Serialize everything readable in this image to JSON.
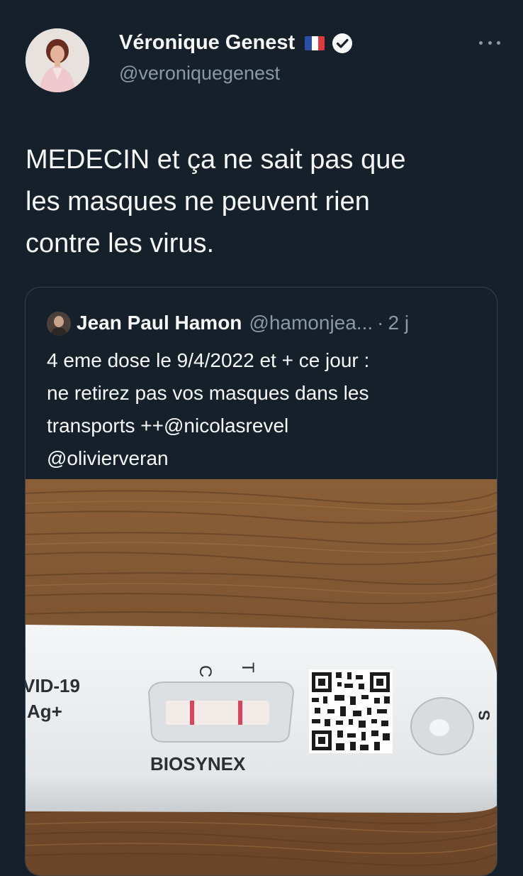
{
  "author": {
    "name": "Véronique Genest",
    "handle": "@veroniquegenest"
  },
  "tweet": {
    "lines": [
      "MEDECIN et ça ne sait pas que",
      "les masques ne peuvent rien",
      "contre les virus."
    ]
  },
  "quoted": {
    "name": "Jean Paul Hamon",
    "handle": "@hamonjea...",
    "separator": "·",
    "time": "2 j",
    "lines": [
      "4 eme dose le 9/4/2022 et + ce jour :",
      "ne retirez pas vos masques dans les",
      "transports ++@nicolasrevel",
      "@olivierveran"
    ],
    "image": {
      "cassette_text": [
        "VID-19",
        "Ag+"
      ],
      "brand": "BIOSYNEX",
      "marker_c": "C",
      "marker_t": "T",
      "edge_letter": "S"
    }
  },
  "colors": {
    "background": "#15202b",
    "text_primary": "#f7f9f9",
    "text_secondary": "#8b98a5",
    "border": "#38444d",
    "test_line": "#d9455e"
  }
}
